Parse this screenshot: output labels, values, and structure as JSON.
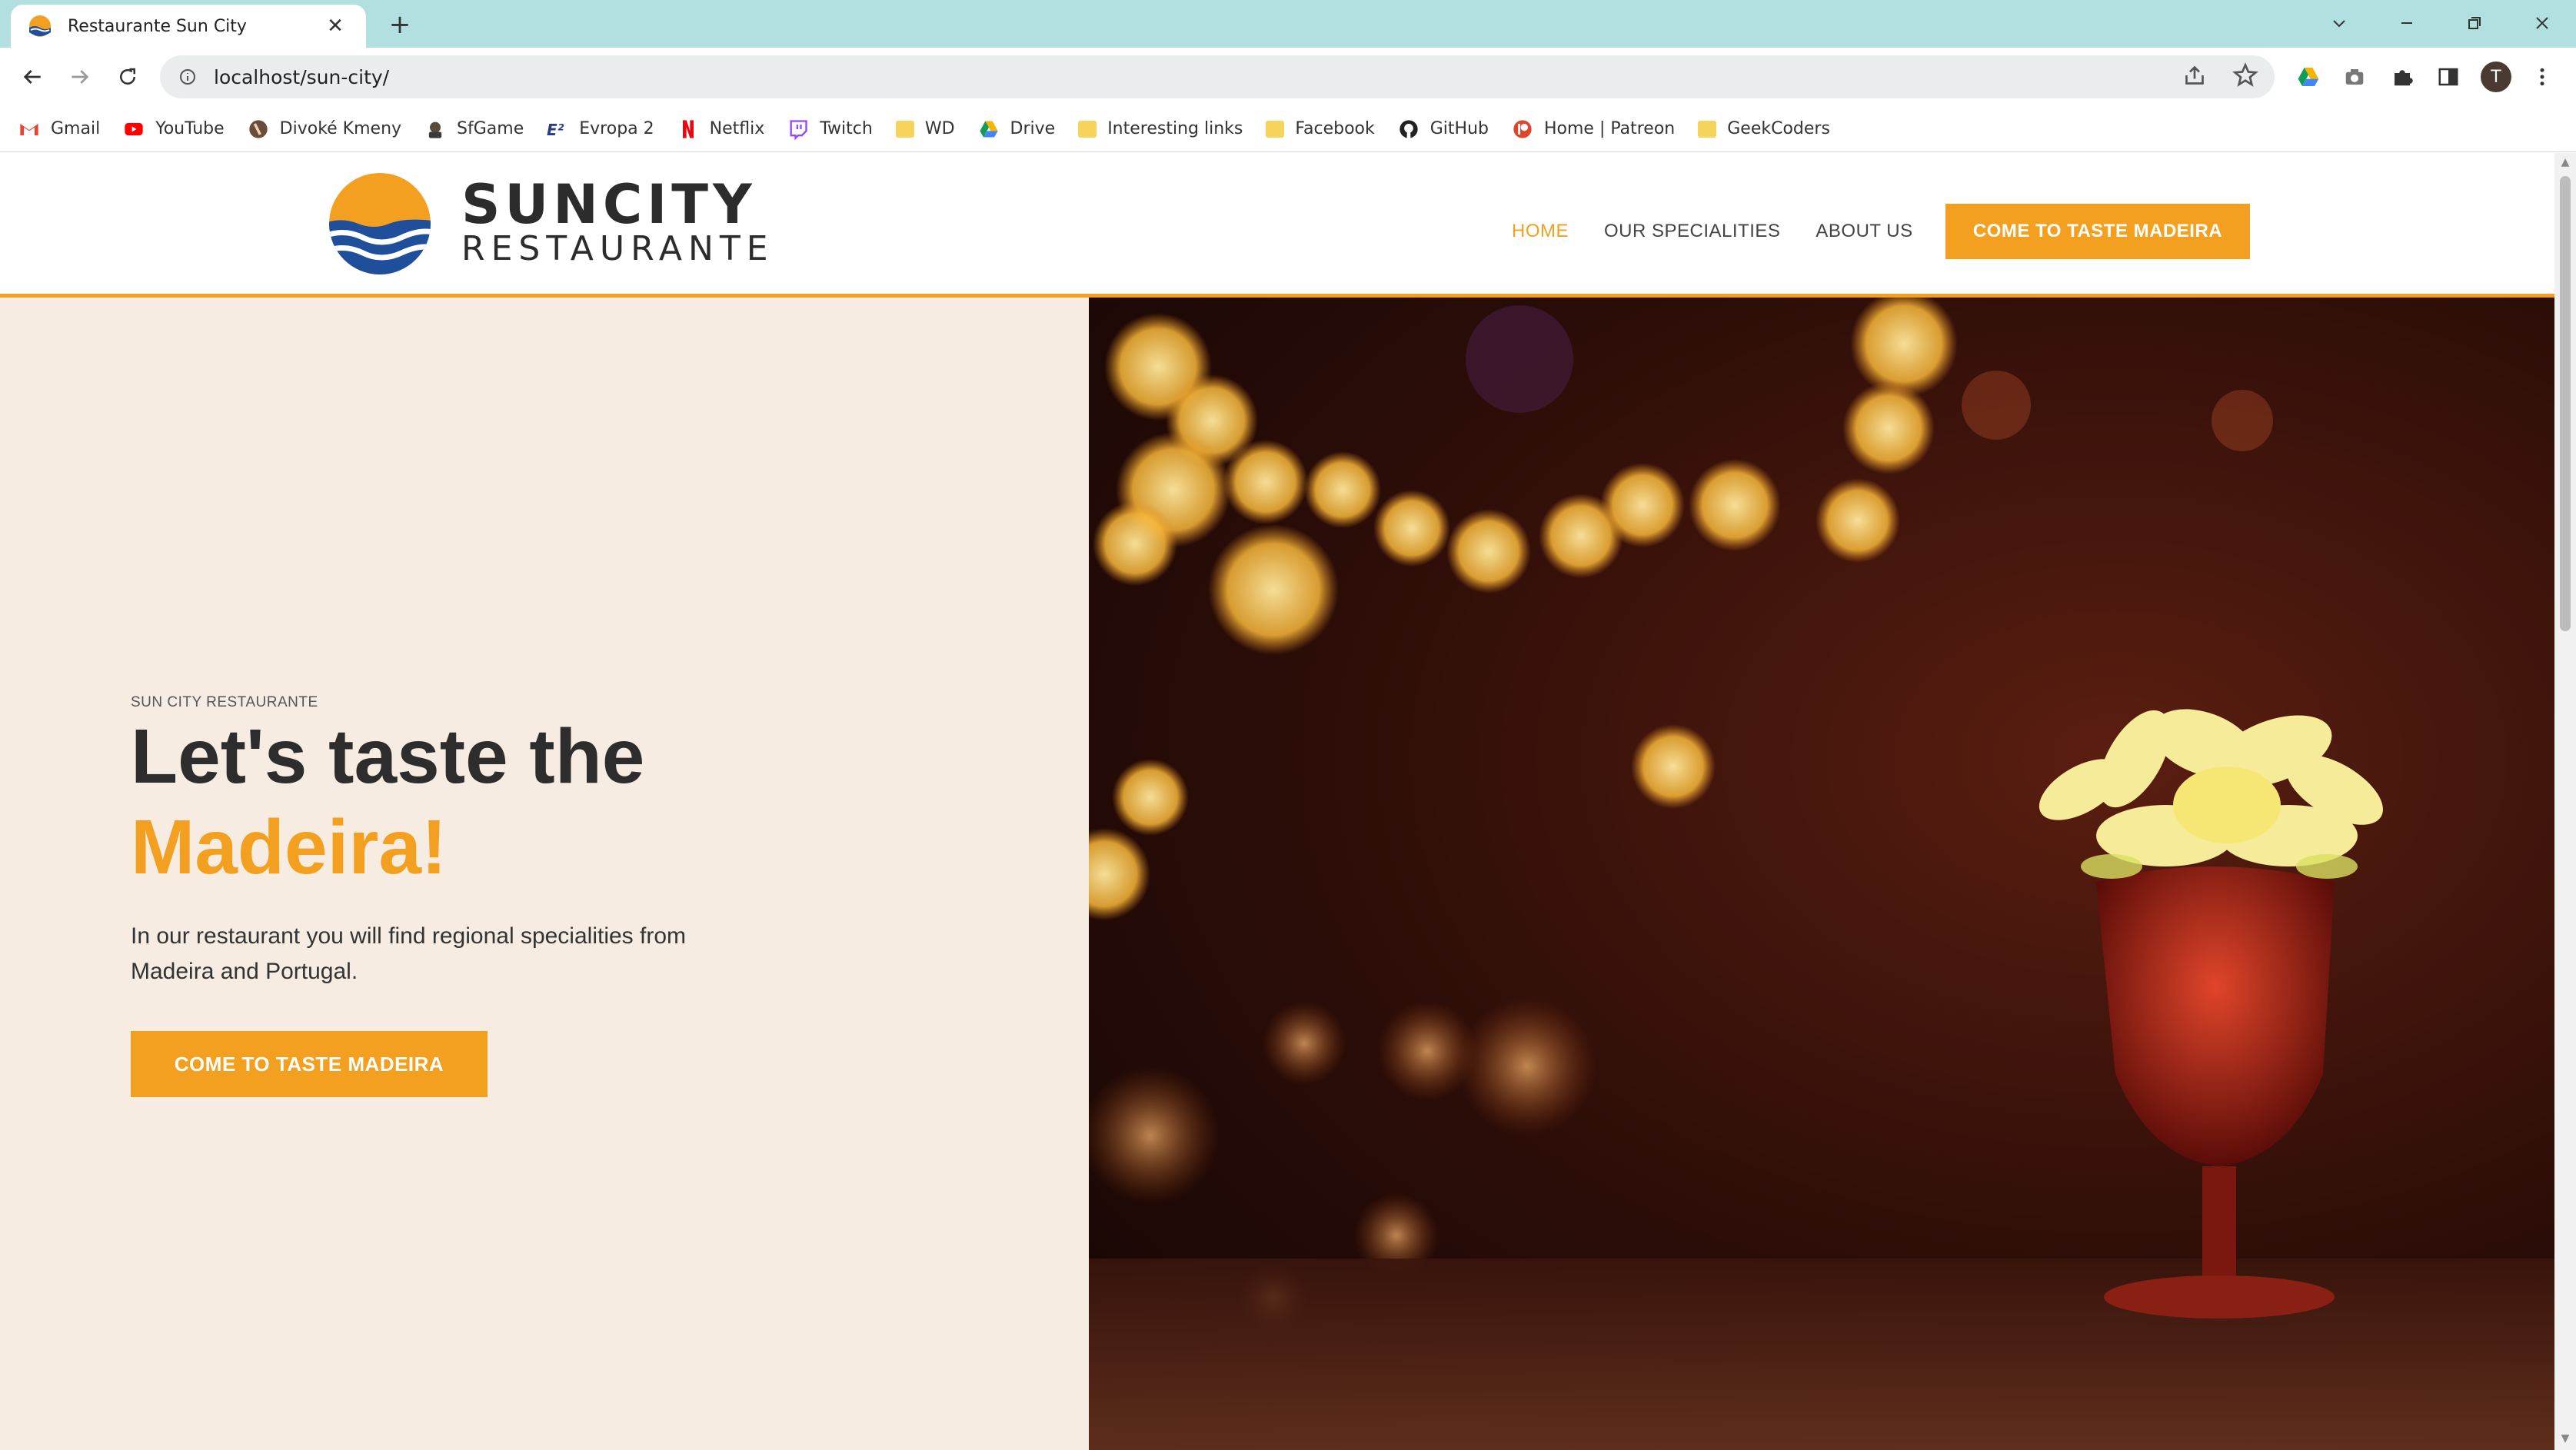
{
  "browser": {
    "tab_title": "Restaurante Sun City",
    "close_glyph": "✕",
    "new_tab_glyph": "+",
    "url": "localhost/sun-city/",
    "avatar_letter": "T",
    "bookmarks": [
      {
        "label": "Gmail",
        "icon": "gmail-icon"
      },
      {
        "label": "YouTube",
        "icon": "youtube-icon"
      },
      {
        "label": "Divoké Kmeny",
        "icon": "divoke-kmeny-icon"
      },
      {
        "label": "SfGame",
        "icon": "sfgame-icon"
      },
      {
        "label": "Evropa 2",
        "icon": "evropa2-icon"
      },
      {
        "label": "Netflix",
        "icon": "netflix-icon"
      },
      {
        "label": "Twitch",
        "icon": "twitch-icon"
      },
      {
        "label": "WD",
        "icon": "folder-icon"
      },
      {
        "label": "Drive",
        "icon": "drive-icon"
      },
      {
        "label": "Interesting links",
        "icon": "folder-icon"
      },
      {
        "label": "Facebook",
        "icon": "folder-icon"
      },
      {
        "label": "GitHub",
        "icon": "github-icon"
      },
      {
        "label": "Home | Patreon",
        "icon": "patreon-icon"
      },
      {
        "label": "GeekCoders",
        "icon": "folder-icon"
      }
    ]
  },
  "site": {
    "logo": {
      "line1": "SUNCITY",
      "line2": "RESTAURANTE"
    },
    "nav": {
      "home": "HOME",
      "specialities": "OUR SPECIALITIES",
      "about": "ABOUT US",
      "cta": "COME TO TASTE MADEIRA"
    },
    "hero": {
      "eyebrow": "SUN CITY RESTAURANTE",
      "headline_line1": "Let's taste the",
      "headline_line2": "Madeira!",
      "lead": "In our restaurant you will find regional specialities from Madeira and Portugal.",
      "cta": "COME TO TASTE MADEIRA"
    }
  },
  "colors": {
    "accent": "#f3a021",
    "hero_bg": "#f6ece2",
    "tabbar": "#b2dfe0"
  }
}
